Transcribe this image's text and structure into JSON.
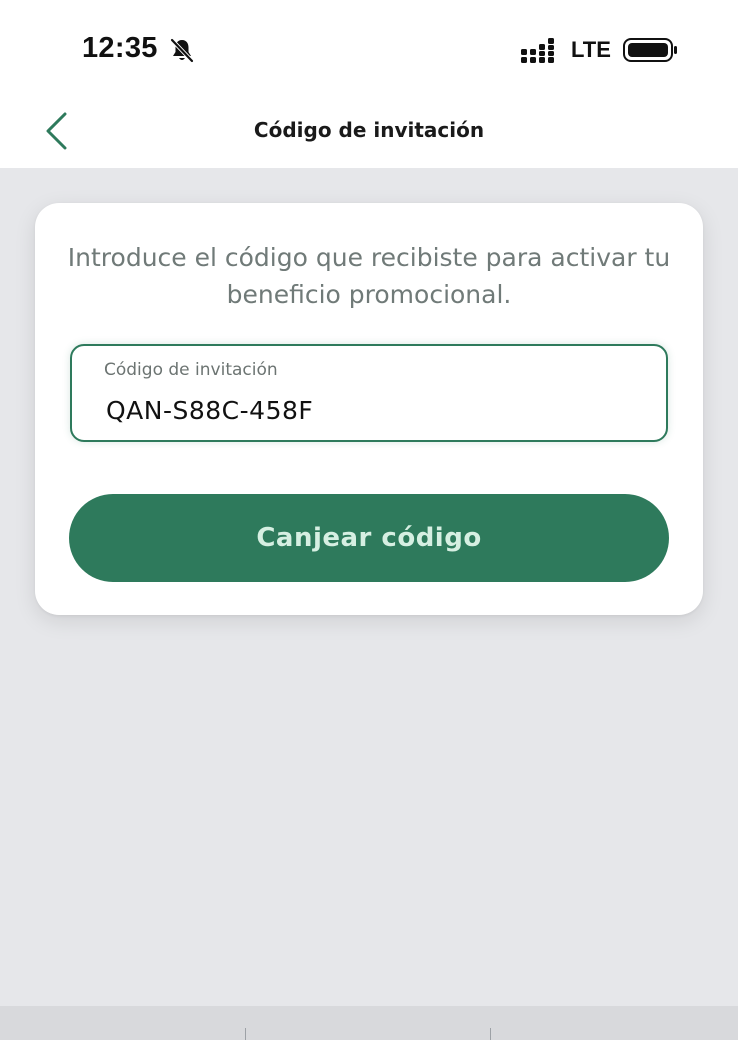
{
  "status_bar": {
    "time": "12:35",
    "network": "LTE",
    "icons": [
      "bell-slash-icon",
      "signal-icon",
      "battery-icon"
    ]
  },
  "nav": {
    "back_icon": "chevron-left-icon",
    "title": "Código de invitación"
  },
  "card": {
    "instructions": "Introduce el código que recibiste para activar tu beneficio promocional.",
    "code_field": {
      "label": "Código de invitación",
      "value": "QAN-S88C-458F"
    },
    "redeem_button_label": "Canjear código"
  },
  "colors": {
    "accent": "#2e7a5c",
    "button_text": "#d6efe2",
    "background": "#e6e7ea",
    "card": "#ffffff",
    "muted_text": "#707a78"
  }
}
